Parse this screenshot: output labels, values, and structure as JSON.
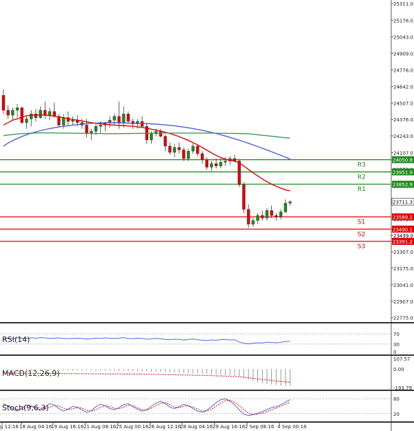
{
  "chart_data": {
    "type": "candlestick",
    "price_axis": {
      "ticks": [
        25311.0,
        25176.0,
        25043.0,
        24909.0,
        24776.0,
        24642.0,
        24507.0,
        24376.0,
        24243.0,
        24107.0,
        23973.0,
        23839.0,
        23706.0,
        23573.0,
        23439.0,
        23307.0,
        23175.0,
        23041.0,
        22907.0,
        22775.0
      ],
      "ylim": [
        22740,
        25340
      ]
    },
    "time_axis": {
      "ticks": [
        "g 12:16",
        "18 Aug 04:16",
        "19 Aug 16:16",
        "21 Aug 08:16",
        "25 Aug 00:16",
        "26 Aug 12:16",
        "28 Aug 04:16",
        "29 Aug 16:16",
        "2 Sep 08:16",
        "4 Sep 00:16"
      ]
    },
    "levels": [
      {
        "name": "R3",
        "price_label": "24050.8",
        "value": 24050.8,
        "color": "#1f8a1f"
      },
      {
        "name": "R2",
        "price_label": "23951.9",
        "value": 23951.9,
        "color": "#1f8a1f"
      },
      {
        "name": "R1",
        "price_label": "23852.9",
        "value": 23852.9,
        "color": "#1f8a1f"
      },
      {
        "name": "S1",
        "price_label": "23589.1",
        "value": 23589.1,
        "color": "#e00000"
      },
      {
        "name": "S2",
        "price_label": "23490.1",
        "value": 23490.1,
        "color": "#e00000"
      },
      {
        "name": "S3",
        "price_label": "23391.2",
        "value": 23391.2,
        "color": "#e00000"
      }
    ],
    "current_price": {
      "label": "23711.3",
      "value": 23711.3
    },
    "extra_tick": {
      "label": "23439.0",
      "value": 23439.0
    },
    "ohlc": [
      [
        24570,
        24620,
        24420,
        24450
      ],
      [
        24450,
        24490,
        24380,
        24410
      ],
      [
        24410,
        24470,
        24370,
        24450
      ],
      [
        24450,
        24500,
        24390,
        24470
      ],
      [
        24470,
        24480,
        24340,
        24350
      ],
      [
        24350,
        24400,
        24300,
        24380
      ],
      [
        24380,
        24450,
        24320,
        24420
      ],
      [
        24420,
        24460,
        24360,
        24390
      ],
      [
        24390,
        24480,
        24380,
        24450
      ],
      [
        24450,
        24520,
        24380,
        24410
      ],
      [
        24410,
        24470,
        24370,
        24440
      ],
      [
        24440,
        24510,
        24390,
        24400
      ],
      [
        24400,
        24420,
        24310,
        24330
      ],
      [
        24330,
        24420,
        24300,
        24390
      ],
      [
        24390,
        24440,
        24330,
        24360
      ],
      [
        24360,
        24400,
        24330,
        24370
      ],
      [
        24370,
        24410,
        24320,
        24350
      ],
      [
        24350,
        24380,
        24300,
        24330
      ],
      [
        24330,
        24380,
        24230,
        24260
      ],
      [
        24260,
        24300,
        24210,
        24280
      ],
      [
        24280,
        24350,
        24250,
        24320
      ],
      [
        24320,
        24360,
        24270,
        24330
      ],
      [
        24330,
        24360,
        24280,
        24350
      ],
      [
        24350,
        24400,
        24310,
        24370
      ],
      [
        24370,
        24420,
        24330,
        24400
      ],
      [
        24400,
        24520,
        24300,
        24350
      ],
      [
        24350,
        24480,
        24310,
        24420
      ],
      [
        24420,
        24440,
        24340,
        24360
      ],
      [
        24360,
        24380,
        24300,
        24340
      ],
      [
        24340,
        24380,
        24300,
        24360
      ],
      [
        24360,
        24400,
        24310,
        24320
      ],
      [
        24320,
        24340,
        24180,
        24210
      ],
      [
        24210,
        24280,
        24180,
        24260
      ],
      [
        24260,
        24300,
        24240,
        24280
      ],
      [
        24280,
        24300,
        24230,
        24240
      ],
      [
        24240,
        24250,
        24120,
        24160
      ],
      [
        24160,
        24190,
        24090,
        24110
      ],
      [
        24110,
        24180,
        24070,
        24150
      ],
      [
        24150,
        24190,
        24100,
        24130
      ],
      [
        24130,
        24150,
        24040,
        24060
      ],
      [
        24060,
        24140,
        24040,
        24120
      ],
      [
        24120,
        24180,
        24100,
        24160
      ],
      [
        24160,
        24170,
        24080,
        24100
      ],
      [
        24100,
        24120,
        24020,
        24050
      ],
      [
        24050,
        24070,
        23970,
        23990
      ],
      [
        23990,
        24040,
        23960,
        24020
      ],
      [
        24020,
        24060,
        23980,
        24000
      ],
      [
        24000,
        24060,
        23980,
        24030
      ],
      [
        24030,
        24070,
        24000,
        24040
      ],
      [
        24040,
        24080,
        24010,
        24060
      ],
      [
        24060,
        24090,
        24030,
        24040
      ],
      [
        24040,
        24050,
        23830,
        23850
      ],
      [
        23850,
        23870,
        23620,
        23650
      ],
      [
        23650,
        23690,
        23500,
        23530
      ],
      [
        23530,
        23580,
        23510,
        23560
      ],
      [
        23560,
        23620,
        23530,
        23600
      ],
      [
        23600,
        23640,
        23560,
        23580
      ],
      [
        23580,
        23660,
        23560,
        23640
      ],
      [
        23640,
        23680,
        23580,
        23600
      ],
      [
        23600,
        23620,
        23560,
        23590
      ],
      [
        23590,
        23650,
        23570,
        23630
      ],
      [
        23630,
        23730,
        23620,
        23700
      ],
      [
        23700,
        23720,
        23680,
        23711
      ]
    ],
    "overlays": [
      {
        "name": "red-ma",
        "color": "#e00000",
        "values": [
          24330,
          24350,
          24370,
          24380,
          24395,
          24405,
          24410,
          24412,
          24412,
          24410,
          24407,
          24402,
          24396,
          24390,
          24383,
          24376,
          24370,
          24363,
          24356,
          24350,
          24345,
          24340,
          24336,
          24333,
          24330,
          24328,
          24326,
          24323,
          24320,
          24316,
          24311,
          24304,
          24297,
          24290,
          24282,
          24273,
          24262,
          24250,
          24237,
          24222,
          24206,
          24188,
          24170,
          24150,
          24127,
          24106,
          24086,
          24068,
          24055,
          24045,
          24040,
          24025,
          24000,
          23972,
          23945,
          23920,
          23895,
          23873,
          23853,
          23836,
          23821,
          23808,
          23798
        ]
      },
      {
        "name": "blue-ma",
        "color": "#4a5fd8",
        "values": [
          24160,
          24185,
          24205,
          24222,
          24238,
          24252,
          24264,
          24275,
          24285,
          24294,
          24302,
          24309,
          24315,
          24320,
          24325,
          24330,
          24334,
          24338,
          24341,
          24344,
          24346,
          24348,
          24349,
          24349,
          24349,
          24348,
          24347,
          24346,
          24345,
          24344,
          24343,
          24342,
          24340,
          24338,
          24335,
          24332,
          24328,
          24324,
          24319,
          24314,
          24308,
          24302,
          24295,
          24288,
          24280,
          24271,
          24262,
          24252,
          24242,
          24231,
          24220,
          24208,
          24196,
          24183,
          24170,
          24157,
          24143,
          24129,
          24115,
          24100,
          24086,
          24072,
          24055
        ]
      },
      {
        "name": "green-ma",
        "color": "#3a9a5a",
        "values": [
          24245,
          24250,
          24254,
          24258,
          24261,
          24263,
          24265,
          24266,
          24267,
          24267,
          24267,
          24267,
          24266,
          24266,
          24265,
          24265,
          24264,
          24264,
          24263,
          24263,
          24262,
          24262,
          24261,
          24261,
          24261,
          24261,
          24262,
          24262,
          24263,
          24263,
          24264,
          24264,
          24265,
          24265,
          24266,
          24266,
          24266,
          24266,
          24266,
          24266,
          24266,
          24266,
          24266,
          24266,
          24266,
          24265,
          24265,
          24264,
          24264,
          24263,
          24263,
          24262,
          24261,
          24259,
          24256,
          24252,
          24248,
          24244,
          24240,
          24236,
          24232,
          24228,
          24225
        ]
      }
    ],
    "rsi": {
      "label": "RSI(14)",
      "ticks": [
        "70",
        "30",
        "0"
      ],
      "ylim": [
        0,
        100
      ],
      "values": [
        52,
        53,
        51,
        54,
        53,
        52,
        54,
        53,
        55,
        54,
        52,
        53,
        54,
        52,
        51,
        52,
        53,
        52,
        50,
        51,
        53,
        52,
        54,
        53,
        52,
        53,
        55,
        52,
        51,
        53,
        52,
        49,
        50,
        52,
        51,
        48,
        47,
        49,
        48,
        46,
        48,
        50,
        47,
        45,
        44,
        46,
        45,
        47,
        48,
        46,
        47,
        38,
        33,
        31,
        33,
        35,
        34,
        37,
        36,
        35,
        37,
        40,
        41
      ]
    },
    "macd": {
      "label": "MACD(12,26,9)",
      "ticks": [
        "107.57",
        "0.00",
        "-193.79"
      ],
      "ylim": [
        -193.79,
        107.57
      ],
      "signal": [
        -40,
        -42,
        -43,
        -44,
        -45,
        -45,
        -46,
        -46,
        -47,
        -47,
        -47,
        -48,
        -48,
        -48,
        -49,
        -49,
        -49,
        -50,
        -50,
        -50,
        -51,
        -51,
        -51,
        -52,
        -52,
        -52,
        -53,
        -53,
        -53,
        -54,
        -54,
        -55,
        -56,
        -57,
        -58,
        -59,
        -60,
        -61,
        -62,
        -63,
        -64,
        -65,
        -66,
        -67,
        -69,
        -70,
        -72,
        -73,
        -75,
        -77,
        -79,
        -82,
        -86,
        -92,
        -98,
        -104,
        -110,
        -115,
        -120,
        -125,
        -130,
        -134,
        -138
      ],
      "hist": [
        -8,
        -10,
        -11,
        -12,
        -12,
        -13,
        -13,
        -14,
        -14,
        -14,
        -15,
        -15,
        -15,
        -16,
        -16,
        -16,
        -17,
        -17,
        -18,
        -18,
        -18,
        -19,
        -19,
        -20,
        -20,
        -21,
        -21,
        -22,
        -22,
        -23,
        -24,
        -26,
        -28,
        -30,
        -32,
        -34,
        -36,
        -38,
        -40,
        -42,
        -44,
        -46,
        -48,
        -50,
        -53,
        -56,
        -59,
        -62,
        -65,
        -68,
        -72,
        -80,
        -95,
        -112,
        -128,
        -140,
        -150,
        -158,
        -164,
        -168,
        -172,
        -175,
        -178
      ]
    },
    "stoch": {
      "label": "Stoch(9,6,3)",
      "ticks": [
        "80",
        "20"
      ],
      "ylim": [
        0,
        100
      ],
      "k": [
        60,
        50,
        38,
        30,
        42,
        55,
        50,
        40,
        35,
        45,
        60,
        55,
        40,
        30,
        38,
        50,
        45,
        35,
        25,
        32,
        48,
        58,
        52,
        40,
        36,
        44,
        56,
        60,
        48,
        38,
        30,
        36,
        50,
        62,
        70,
        60,
        46,
        40,
        48,
        58,
        52,
        40,
        30,
        26,
        34,
        48,
        64,
        76,
        80,
        70,
        56,
        35,
        18,
        12,
        16,
        22,
        28,
        36,
        44,
        48,
        56,
        66,
        76
      ],
      "d": [
        55,
        52,
        45,
        38,
        36,
        44,
        50,
        48,
        42,
        40,
        46,
        52,
        50,
        42,
        36,
        40,
        45,
        42,
        34,
        30,
        36,
        46,
        52,
        48,
        42,
        40,
        46,
        54,
        52,
        44,
        36,
        34,
        42,
        52,
        62,
        64,
        56,
        46,
        44,
        50,
        52,
        46,
        38,
        30,
        30,
        38,
        50,
        62,
        72,
        74,
        66,
        52,
        36,
        22,
        16,
        18,
        22,
        28,
        36,
        42,
        50,
        58,
        66
      ]
    }
  }
}
